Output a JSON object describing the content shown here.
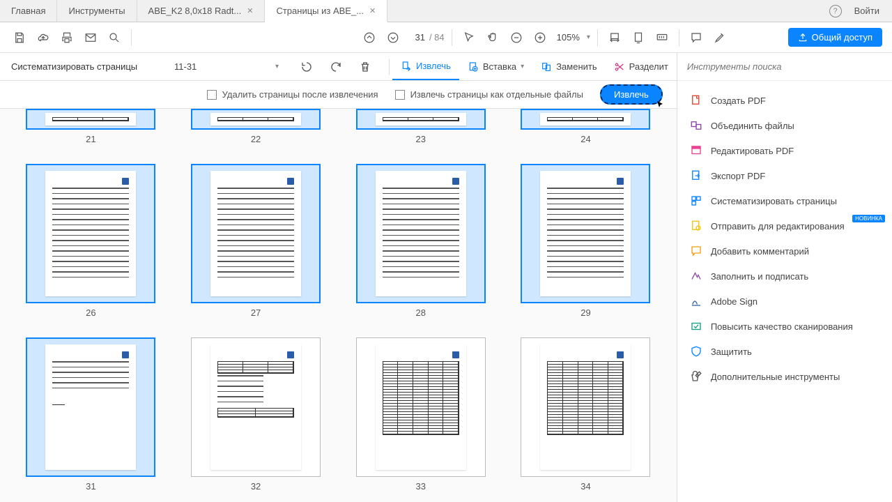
{
  "tabs": {
    "home": "Главная",
    "tools": "Инструменты",
    "doc1": "ABE_K2 8,0x18 Radt...",
    "doc2": "Страницы из ABE_..."
  },
  "topright": {
    "login": "Войти"
  },
  "toolbar": {
    "page_current": "31",
    "page_total": "/  84",
    "zoom": "105%"
  },
  "share": "Общий доступ",
  "subbar": {
    "title": "Систематизировать страницы",
    "range": "11-31",
    "extract": "Извлечь",
    "insert": "Вставка",
    "replace": "Заменить",
    "split": "Разделит"
  },
  "options": {
    "delete_after": "Удалить страницы после извлечения",
    "separate_files": "Извлечь страницы как отдельные файлы",
    "extract_btn": "Извлечь"
  },
  "pages": {
    "row0": [
      "21",
      "22",
      "23",
      "24"
    ],
    "row1": [
      "26",
      "27",
      "28",
      "29"
    ],
    "row2": [
      "31",
      "32",
      "33",
      "34"
    ]
  },
  "rpanel": {
    "search_ph": "Инструменты поиска",
    "t0": "Создать PDF",
    "t1": "Объединить файлы",
    "t2": "Редактировать PDF",
    "t3": "Экспорт PDF",
    "t4": "Систематизировать страницы",
    "t5": "Отправить для редактирования",
    "t5_badge": "НОВИНКА",
    "t6": "Добавить комментарий",
    "t7": "Заполнить и подписать",
    "t8": "Adobe Sign",
    "t9": "Повысить качество сканирования",
    "t10": "Защитить",
    "t11": "Дополнительные инструменты"
  }
}
